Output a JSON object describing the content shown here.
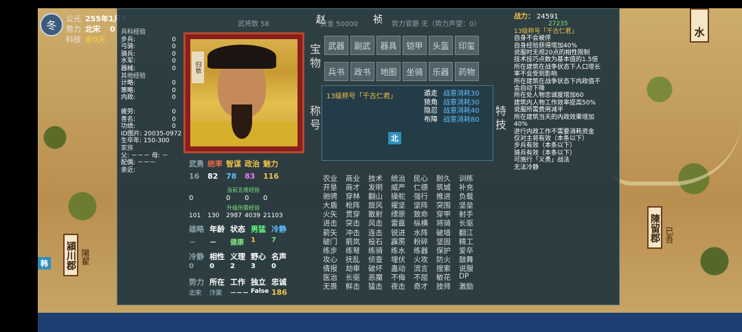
{
  "hud": {
    "season": "冬",
    "era_label": "公元",
    "date": "255年1月1",
    "force_label": "势力",
    "force_value": "北宋",
    "force_num": "0",
    "tech_label": "科技",
    "tech_value": "余0天"
  },
  "map": {
    "cities": [
      {
        "name": "潁川郡",
        "sub": "陽翟"
      },
      {
        "name": "陳留郡",
        "sub": "已吾"
      },
      {
        "name": "水",
        "sub": ""
      }
    ],
    "flags": [
      "韩",
      "北"
    ]
  },
  "panel": {
    "name_first": "赵",
    "name_last": "祯",
    "dim_texts": [
      "武将数 58",
      "资金 50000",
      "势力官爵 无（势力声望：0）",
      "宝物",
      "称号",
      "特技"
    ],
    "portrait_tag": "归依",
    "left": {
      "arms_header": "兵科经验",
      "arms": [
        {
          "label": "步兵:",
          "value": "0"
        },
        {
          "label": "弓骑:",
          "value": "0"
        },
        {
          "label": "骑兵:",
          "value": "0"
        },
        {
          "label": "水军:",
          "value": "0"
        },
        {
          "label": "器械:",
          "value": "0"
        }
      ],
      "other_header": "其他经验",
      "other": [
        {
          "label": "计略:",
          "value": "0"
        },
        {
          "label": "策略:",
          "value": "0"
        },
        {
          "label": "内政:",
          "value": "0"
        }
      ],
      "fatigue": [
        {
          "label": "疲劳:",
          "value": "0"
        },
        {
          "label": "善名:",
          "value": "0"
        },
        {
          "label": "功绩:",
          "value": "0"
        }
      ],
      "id_label": "ID图片:",
      "id_value": "20035-0972",
      "birth_label": "生卒年:",
      "birth_value": "150-300",
      "family_label": "家族",
      "father_label": "父:",
      "father_value": "－－－",
      "mother_label": "母:",
      "mother_value": "－",
      "spouse_label": "配偶:",
      "spouse_value": "－－－",
      "other_rel_label": "亲近:"
    },
    "tabs": [
      "武器",
      "副武",
      "器具",
      "铠甲",
      "头盔",
      "印玺",
      "兵书",
      "政书",
      "地图",
      "坐骑",
      "乐器",
      "药物"
    ],
    "title_box": {
      "title": "13级称号「千古仁君」",
      "items": [
        {
          "k": "遁走",
          "v": "战意消耗30"
        },
        {
          "k": "猗角",
          "v": "战意消耗30"
        },
        {
          "k": "隐忍",
          "v": "战意消耗40"
        },
        {
          "k": "布障",
          "v": "战意消耗80"
        }
      ]
    },
    "stats_headers": [
      "武勇",
      "统率",
      "智谋",
      "政治",
      "魅力"
    ],
    "stats_values": [
      "16",
      "82",
      "78",
      "83",
      "116"
    ],
    "stats_colors": [
      "#ffffff",
      "#ffffff",
      "#5fbfff",
      "#e87fe8",
      "#f2c24a"
    ],
    "exp_note1": "当前五维经验",
    "exp_note2": "升级所需经验",
    "exp_values": [
      "0",
      "0",
      "0",
      "0"
    ],
    "exp_values2": [
      "101",
      "130",
      "2987",
      "4039",
      "21103"
    ],
    "trait_headers": [
      "雄略",
      "年龄",
      "状态",
      "男猛",
      "冷静"
    ],
    "trait_values": [
      "－",
      "－",
      "健康",
      "1",
      "7"
    ],
    "trait2_headers": [
      "冷静",
      "相性",
      "义理",
      "野心",
      "名声"
    ],
    "trait2_values": [
      "0",
      "0",
      "2",
      "3",
      "0"
    ],
    "loc_headers": [
      "势力",
      "所在",
      "工作",
      "独立",
      "忠诚"
    ],
    "loc_values": [
      "北宋",
      "汴梁",
      "－－－",
      "False",
      "186"
    ],
    "skills": [
      "农业",
      "商业",
      "技术",
      "统治",
      "民心",
      "耐久",
      "训练",
      "开垦",
      "商才",
      "发明",
      "威严",
      "仁德",
      "筑城",
      "补充",
      "驰骋",
      "穿林",
      "翻山",
      "操舵",
      "强行",
      "推进",
      "负载",
      "大盾",
      "枪阵",
      "旋风",
      "擢坚",
      "坚阵",
      "突围",
      "坚垒",
      "火矢",
      "贯穿",
      "散射",
      "缥原",
      "致命",
      "穿甲",
      "射手",
      "进击",
      "突击",
      "风击",
      "雷霆",
      "纵横",
      "将骑",
      "长驱",
      "箭矢",
      "冲击",
      "连击",
      "锐进",
      "水阵",
      "破墙",
      "翻江",
      "破门",
      "箭岚",
      "投石",
      "霹雳",
      "粉碎",
      "坚固",
      "精工",
      "练步",
      "练弩",
      "练骑",
      "练水",
      "练器",
      "保护",
      "爱卒",
      "攻心",
      "抚乱",
      "侦查",
      "埋伏",
      "火攻",
      "防火",
      "鼓舞",
      "倩报",
      "劫审",
      "破坏",
      "蛊动",
      "流言",
      "搜索",
      "说服",
      "医治",
      "长驱",
      "恶魔",
      "不侮",
      "不屈",
      "敏花",
      "DP",
      "无畏",
      "鲜击",
      "猛击",
      "夜击",
      "奇才",
      "技师",
      "激励"
    ],
    "right": {
      "power_label": "战力：",
      "power_value": "24591",
      "power_exp": "27235",
      "title": "13级称号「千古仁君」",
      "lines": [
        "自身不会被俘",
        "自身经验获得增加40%",
        "说服时无视20点的相性限制",
        "技术技巧点数为基本值的1.5倍",
        "所在建筑在战争状态下人口增长率不会受到影响",
        "所在建筑在战争状态下内政值不会自动下降",
        "所在处人物忠诚度增加60",
        "建筑内人物工作效率提高50%",
        "说服所需费用减半",
        "所在建筑当天的内政效果增加40%",
        "进行内政工作不需要消耗资金",
        "仅对主将有效（本条以下）",
        "步兵有效（本条以下）",
        "骑兵有效（本条以下）",
        "可施行「义勇」战法",
        "无法冷静"
      ]
    }
  }
}
